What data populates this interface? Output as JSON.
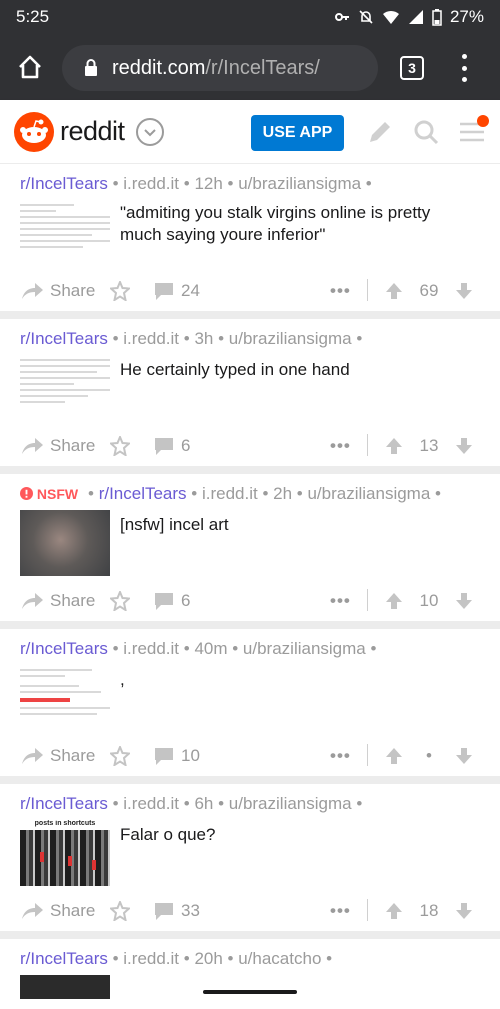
{
  "status": {
    "time": "5:25",
    "battery": "27%"
  },
  "browser": {
    "url_domain": "reddit.com",
    "url_path": "/r/IncelTears/",
    "tab_count": "3"
  },
  "header": {
    "logo_text": "reddit",
    "use_app": "USE APP"
  },
  "action_labels": {
    "share": "Share"
  },
  "posts": [
    {
      "subreddit": "r/IncelTears",
      "domain": "i.redd.it",
      "age": "12h",
      "user": "u/braziliansigma",
      "title": "\"admiting you stalk virgins online is pretty much saying youre inferior\"",
      "comments": "24",
      "score": "69",
      "nsfw": ""
    },
    {
      "subreddit": "r/IncelTears",
      "domain": "i.redd.it",
      "age": "3h",
      "user": "u/braziliansigma",
      "title": "He certainly typed in one hand",
      "comments": "6",
      "score": "13",
      "nsfw": ""
    },
    {
      "subreddit": "r/IncelTears",
      "domain": "i.redd.it",
      "age": "2h",
      "user": "u/braziliansigma",
      "title": "[nsfw] incel art",
      "comments": "6",
      "score": "10",
      "nsfw": "NSFW"
    },
    {
      "subreddit": "r/IncelTears",
      "domain": "i.redd.it",
      "age": "40m",
      "user": "u/braziliansigma",
      "title": ",",
      "comments": "10",
      "score": "•",
      "nsfw": ""
    },
    {
      "subreddit": "r/IncelTears",
      "domain": "i.redd.it",
      "age": "6h",
      "user": "u/braziliansigma",
      "title": "Falar o que?",
      "comments": "33",
      "score": "18",
      "nsfw": "",
      "thumb_caption": "posts in shortcuts"
    },
    {
      "subreddit": "r/IncelTears",
      "domain": "i.redd.it",
      "age": "20h",
      "user": "u/hacatcho",
      "title": "",
      "comments": "",
      "score": "",
      "nsfw": ""
    }
  ],
  "colors": {
    "accent": "#0079d3",
    "brand": "#ff4500",
    "subreddit": "#6a5bd3",
    "muted": "#9b9b9b"
  }
}
